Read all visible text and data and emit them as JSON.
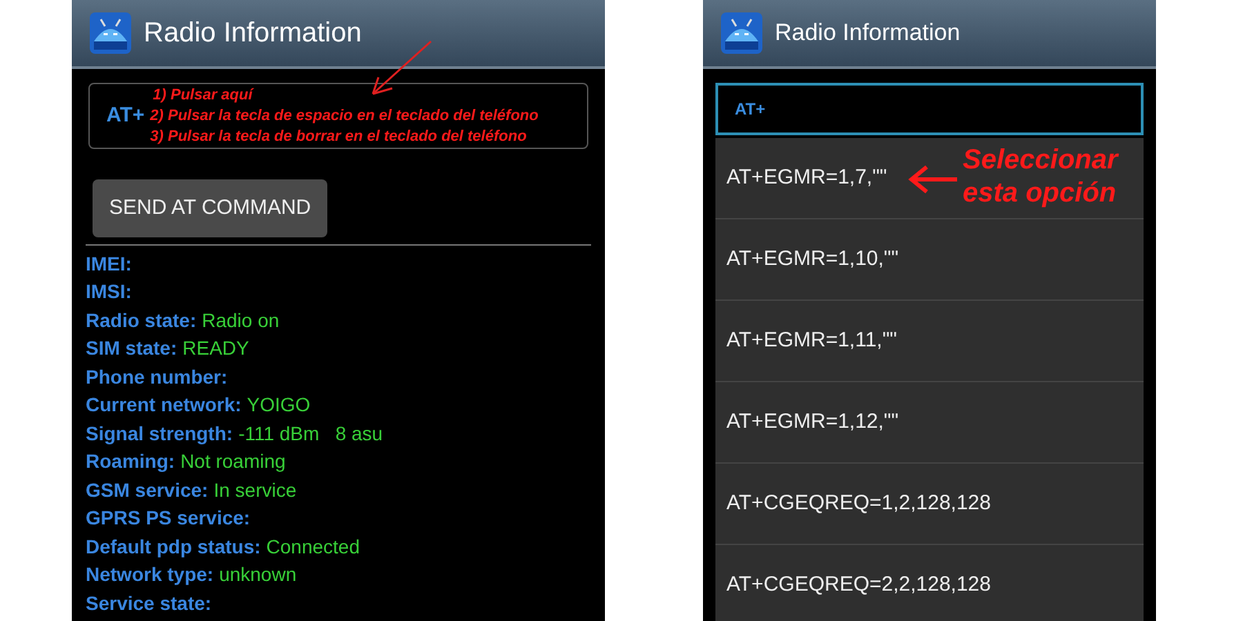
{
  "left_screen": {
    "title": "Radio Information",
    "command_field": {
      "value": "AT+"
    },
    "annotation_steps": [
      "1) Pulsar aquí",
      "2) Pulsar la tecla de espacio en el teclado del teléfono",
      "3) Pulsar la tecla de borrar en el teclado del teléfono"
    ],
    "send_button": "SEND AT COMMAND",
    "info_rows": [
      {
        "label": "IMEI:"
      },
      {
        "label": "IMSI:"
      },
      {
        "label": "Radio state:",
        "value": "Radio on"
      },
      {
        "label": "SIM state:",
        "value": "READY"
      },
      {
        "label": "Phone number:"
      },
      {
        "label": "Current network:",
        "value": "YOIGO"
      },
      {
        "label": "Signal strength:",
        "value": "-111 dBm   8 asu"
      },
      {
        "label": "Roaming:",
        "value": "Not roaming"
      },
      {
        "label": "GSM service:",
        "value": "In service"
      },
      {
        "label": "GPRS PS service:"
      },
      {
        "label": "Default pdp status:",
        "value": "Connected"
      },
      {
        "label": "Network type:",
        "value": "unknown"
      },
      {
        "label": "Service state:"
      }
    ]
  },
  "right_screen": {
    "title": "Radio Information",
    "command_field": {
      "value": "AT+"
    },
    "suggestions": [
      "AT+EGMR=1,7,\"\"",
      "AT+EGMR=1,10,\"\"",
      "AT+EGMR=1,11,\"\"",
      "AT+EGMR=1,12,\"\"",
      "AT+CGEQREQ=1,2,128,128",
      "AT+CGEQREQ=2,2,128,128"
    ],
    "annotation": [
      "Seleccionar",
      "esta opción"
    ]
  }
}
